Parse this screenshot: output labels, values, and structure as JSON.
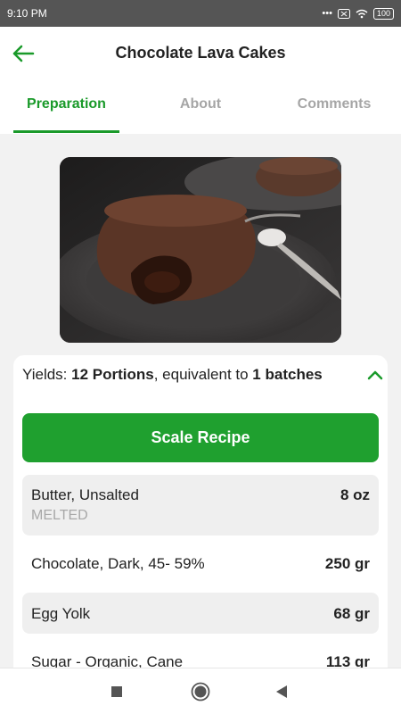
{
  "status_bar": {
    "time": "9:10 PM",
    "battery": "100",
    "icons": [
      "dots-icon",
      "sim-icon",
      "wifi-icon",
      "battery-icon"
    ]
  },
  "header": {
    "title": "Chocolate Lava Cakes",
    "back_icon": "arrow-left-icon"
  },
  "tabs": [
    {
      "label": "Preparation",
      "active": true
    },
    {
      "label": "About",
      "active": false
    },
    {
      "label": "Comments",
      "active": false
    }
  ],
  "yields": {
    "prefix": "Yields: ",
    "portions": "12 Portions",
    "middle": ", equivalent to ",
    "batches_count": "1",
    "batches_word": "batches"
  },
  "scale_button": "Scale Recipe",
  "ingredients": [
    {
      "name": "Butter,  Unsalted",
      "note": "MELTED",
      "qty": "8 oz"
    },
    {
      "name": "Chocolate, Dark, 45- 59%",
      "note": "",
      "qty": "250 gr"
    },
    {
      "name": "Egg Yolk",
      "note": "",
      "qty": "68 gr"
    },
    {
      "name": "Sugar - Organic, Cane",
      "note": "",
      "qty": "113 gr"
    }
  ],
  "nav": {
    "buttons": [
      "recents-square-icon",
      "home-circle-icon",
      "back-triangle-icon"
    ]
  },
  "colors": {
    "accent": "#1a9a2a",
    "button": "#1fa02f",
    "status_bar": "#555555",
    "background": "#f2f2f2"
  }
}
